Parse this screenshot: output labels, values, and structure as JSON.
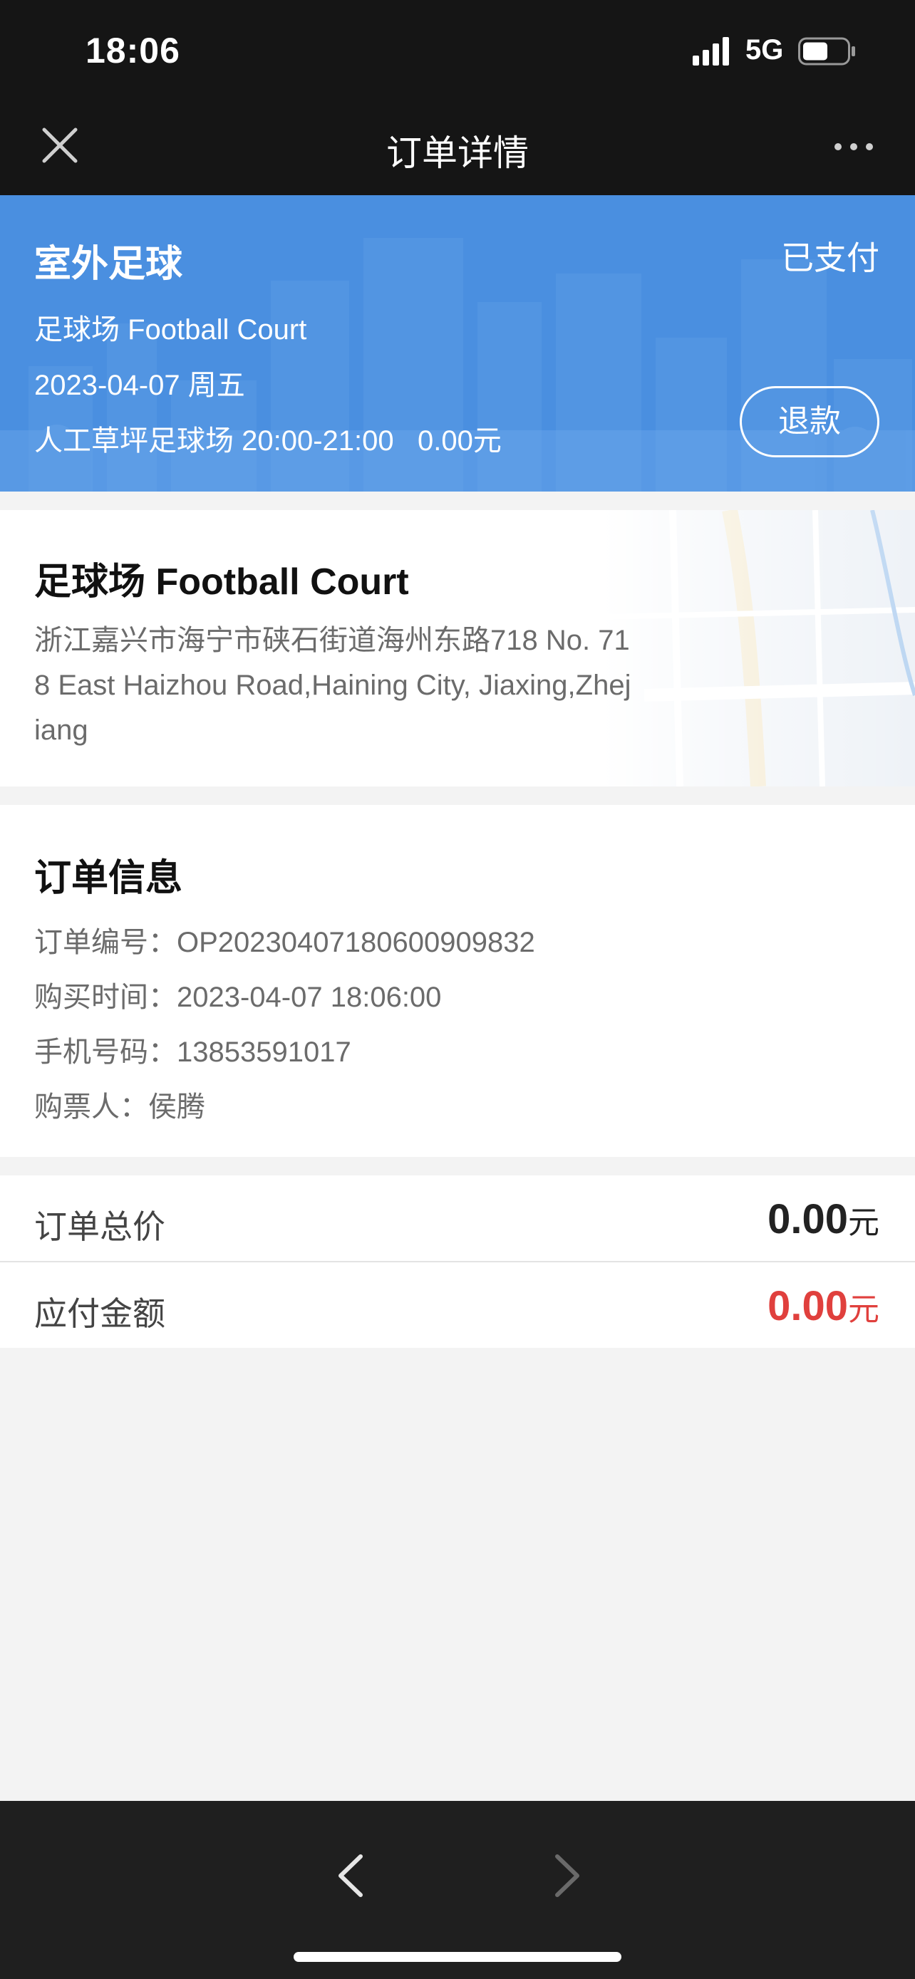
{
  "status_bar": {
    "time": "18:06",
    "network": "5G",
    "icons": [
      "signal-icon",
      "battery-icon"
    ]
  },
  "nav": {
    "title": "订单详情",
    "icons": [
      "close-icon",
      "more-icon"
    ]
  },
  "header": {
    "title": "室外足球",
    "status": "已支付",
    "venue": "足球场 Football Court",
    "date": "2023-04-07 周五",
    "slot": "人工草坪足球场 20:00-21:00   0.00元",
    "refund_label": "退款",
    "background_color": "#4a8fe0"
  },
  "venue": {
    "name": "足球场 Football Court",
    "address": "浙江嘉兴市海宁市硖石街道海州东路718 No. 718 East Haizhou Road,Haining City, Jiaxing,Zhejiang"
  },
  "order_info": {
    "title": "订单信息",
    "rows": [
      "订单编号：OP20230407180600909832",
      "购买时间：2023-04-07 18:06:00",
      "手机号码：13853591017",
      "购票人：侯腾"
    ]
  },
  "prices": {
    "total_label": "订单总价",
    "total_amount": "0.00",
    "total_unit": "元",
    "due_label": "应付金额",
    "due_amount": "0.00",
    "due_unit": "元",
    "due_color": "#e0403d"
  },
  "bottom_bar": {
    "icons": [
      "back-arrow-icon",
      "forward-arrow-icon"
    ]
  }
}
